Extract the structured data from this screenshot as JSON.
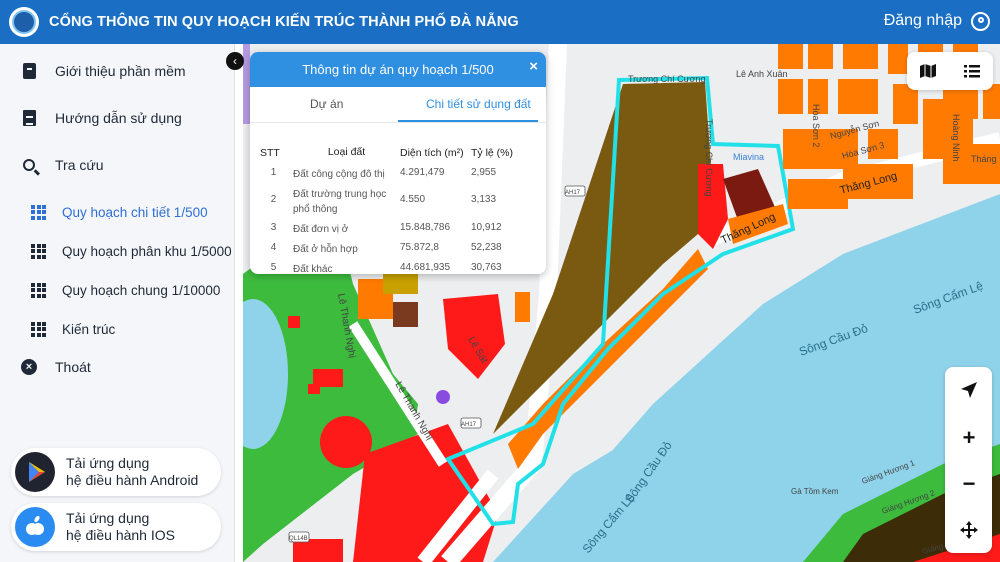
{
  "header": {
    "title": "CỔNG THÔNG TIN QUY HOẠCH KIẾN TRÚC THÀNH PHỐ ĐÀ NẴNG",
    "login_label": "Đăng nhập",
    "bg_color": "#1a6fc4"
  },
  "sidebar": {
    "items": [
      {
        "label": "Giới thiệu phần mềm",
        "icon": "book-icon"
      },
      {
        "label": "Hướng dẫn sử dụng",
        "icon": "document-icon"
      },
      {
        "label": "Tra cứu",
        "icon": "search-icon"
      }
    ],
    "sub_items": [
      {
        "label": "Quy hoạch chi tiết 1/500",
        "active": true
      },
      {
        "label": "Quy hoạch phân khu 1/5000",
        "active": false
      },
      {
        "label": "Quy hoạch chung 1/10000",
        "active": false
      },
      {
        "label": "Kiến trúc",
        "active": false
      }
    ],
    "exit_label": "Thoát",
    "android": {
      "line1": "Tải ứng dụng",
      "line2": "hệ điều hành Android"
    },
    "ios": {
      "line1": "Tải ứng dụng",
      "line2": "hệ điều hành IOS"
    }
  },
  "panel": {
    "title": "Thông tin dự án quy hoạch 1/500",
    "close": "×",
    "tabs": [
      "Dự án",
      "Chi tiết sử dụng đất"
    ],
    "active_tab": 1,
    "columns": [
      "STT",
      "Loại đất",
      "Diện tích (m²)",
      "Tỷ lệ (%)"
    ],
    "rows": [
      {
        "stt": "1",
        "type": "Đất công cộng đô thị",
        "area": "4.291,479",
        "ratio": "2,955"
      },
      {
        "stt": "2",
        "type": "Đất trường trung học phổ thông",
        "area": "4.550",
        "ratio": "3,133"
      },
      {
        "stt": "3",
        "type": "Đất đơn vị ở",
        "area": "15.848,786",
        "ratio": "10,912"
      },
      {
        "stt": "4",
        "type": "Đất ở hỗn hợp",
        "area": "75.872,8",
        "ratio": "52,238"
      },
      {
        "stt": "5",
        "type": "Đất khác",
        "area": "44.681,935",
        "ratio": "30,763"
      }
    ]
  },
  "map": {
    "labels": {
      "le_thanh_nghi_1": "Lê Thanh Nghị",
      "le_thanh_nghi_2": "Lê Thanh Nghị",
      "thang_long_1": "Thăng Long",
      "thang_long_2": "Thăng Long",
      "song_cam_le_1": "Sông Cẩm Lệ",
      "song_cam_le_2": "Sông Cẩm Lệ",
      "song_cau_do_1": "Sông Cầu Đỏ",
      "song_cau_do_2": "Sông Cầu Đỏ",
      "truong_chi_cuong_1": "Trương Chí Cương",
      "truong_chi_cuong_2": "Trương Chí Cương",
      "le_anh_xuan": "Lê Anh Xuân",
      "nguyen_son": "Nguyễn Sơn",
      "hoa_son_2": "Hòa Sơn 2",
      "hoa_son_3": "Hòa Sơn 3",
      "hoang_ninh": "Hoàng Ninh",
      "thang": "Tháng",
      "miavina": "Miavina",
      "ah17_a": "AH17",
      "ah17_b": "AH17",
      "ql14b": "QL14B",
      "le_sat": "Lê Sát",
      "giang_huong_1": "Giáng Hương 1",
      "giang_huong_2": "Giáng Hương 2",
      "giang_huong_8": "Giáng Hương 8",
      "ga_tom": "Gà Tồm Kem"
    },
    "colors": {
      "water": "#8fd3ea",
      "park": "#3dbb3d",
      "orange": "#ff7a00",
      "red": "#ff1a1a",
      "brown": "#7a5a10",
      "darkred": "#7a1a10",
      "boundary": "#22e0e8"
    }
  },
  "controls": {
    "top": [
      "map-icon",
      "list-icon"
    ],
    "side": [
      "locate-icon",
      "zoom-in-icon",
      "zoom-out-icon",
      "move-icon"
    ]
  }
}
